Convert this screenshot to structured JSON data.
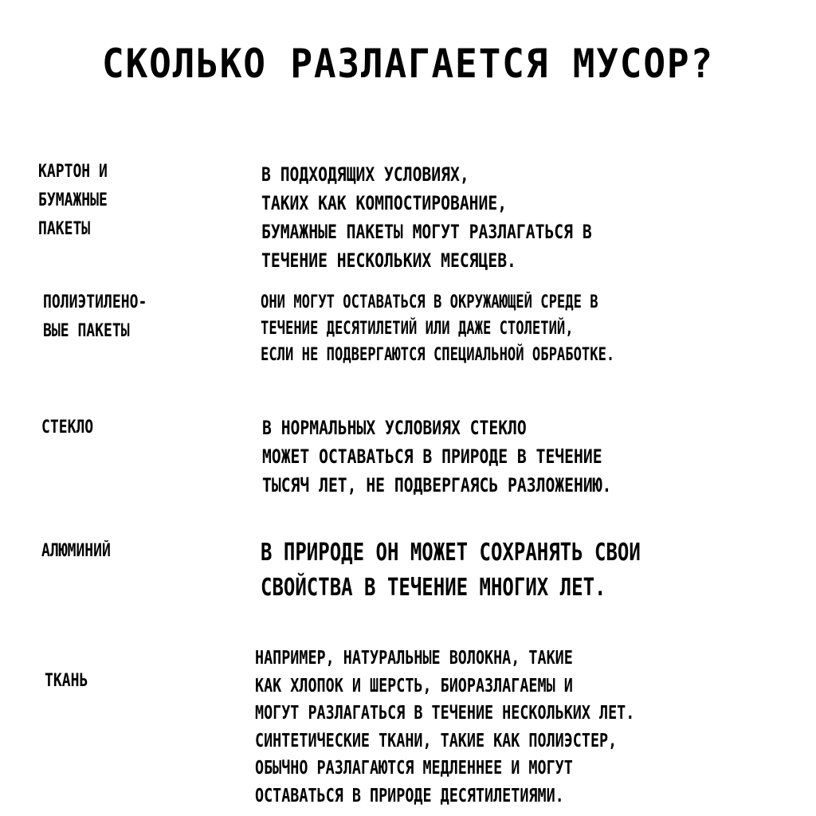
{
  "title": "СКОЛЬКО РАЗЛАГАЕТСЯ МУСОР?",
  "items": [
    {
      "label": "КАРТОН И\nБУМАЖНЫЕ\nПАКЕТЫ",
      "description": "В ПОДХОДЯЩИХ УСЛОВИЯХ,\nТАКИХ КАК КОМПОСТИРОВАНИЕ,\nБУМАЖНЫЕ ПАКЕТЫ МОГУТ РАЗЛАГАТЬСЯ В\nТЕЧЕНИЕ НЕСКОЛЬКИХ МЕСЯЦЕВ."
    },
    {
      "label": "ПОЛИЭТИЛЕНО-\nВЫЕ ПАКЕТЫ",
      "description": "ОНИ МОГУТ ОСТАВАТЬСЯ В ОКРУЖАЮЩЕЙ СРЕДЕ В\nТЕЧЕНИЕ ДЕСЯТИЛЕТИЙ ИЛИ ДАЖЕ СТОЛЕТИЙ,\nЕСЛИ НЕ ПОДВЕРГАЮТСЯ СПЕЦИАЛЬНОЙ ОБРАБОТКЕ."
    },
    {
      "label": "СТЕКЛО",
      "description": "В НОРМАЛЬНЫХ УСЛОВИЯХ СТЕКЛО\nМОЖЕТ ОСТАВАТЬСЯ В ПРИРОДЕ В ТЕЧЕНИЕ\nТЫСЯЧ ЛЕТ, НЕ ПОДВЕРГАЯСЬ РАЗЛОЖЕНИЮ."
    },
    {
      "label": "АЛЮМИНИЙ",
      "description": "В ПРИРОДЕ ОН МОЖЕТ СОХРАНЯТЬ СВОИ\nСВОЙСТВА В ТЕЧЕНИЕ МНОГИХ ЛЕТ."
    },
    {
      "label": "ТКАНЬ",
      "description": "НАПРИМЕР, НАТУРАЛЬНЫЕ ВОЛОКНА, ТАКИЕ\nКАК ХЛОПОК И ШЕРСТЬ, БИОРАЗЛАГАЕМЫ И\nМОГУТ РАЗЛАГАТЬСЯ В ТЕЧЕНИЕ НЕСКОЛЬКИХ ЛЕТ.\nСИНТЕТИЧЕСКИЕ ТКАНИ, ТАКИЕ КАК ПОЛИЭСТЕР,\nОБЫЧНО РАЗЛАГАЮТСЯ МЕДЛЕННЕЕ И МОГУТ\nОСТАВАТЬСЯ В ПРИРОДЕ ДЕСЯТИЛЕТИЯМИ."
    }
  ]
}
